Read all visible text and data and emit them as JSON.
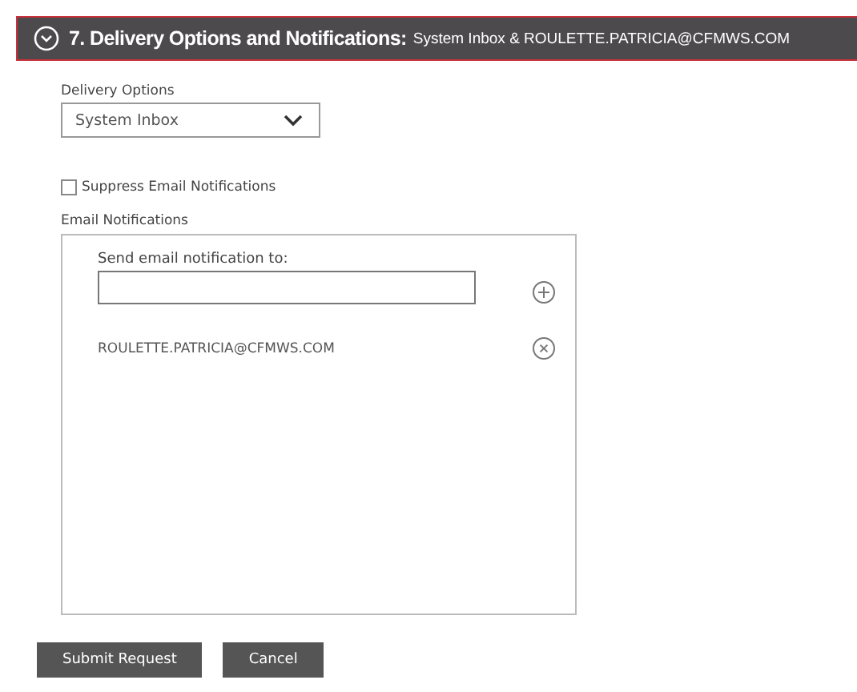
{
  "section": {
    "title": "7. Delivery Options and Notifications:",
    "summary": "System Inbox & ROULETTE.PATRICIA@CFMWS.COM",
    "expanded": true
  },
  "delivery": {
    "label": "Delivery Options",
    "value": "System Inbox"
  },
  "suppress": {
    "label": "Suppress Email Notifications",
    "checked": false
  },
  "notifications": {
    "label": "Email Notifications",
    "field_label": "Send email notification to:",
    "recipients": [
      "ROULETTE.PATRICIA@CFMWS.COM"
    ]
  },
  "buttons": [
    "Submit Request",
    "Cancel"
  ]
}
